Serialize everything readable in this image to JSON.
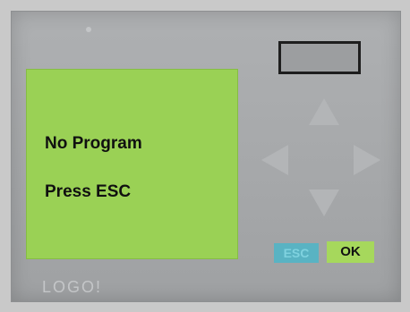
{
  "display": {
    "line1": "No Program",
    "line2": "Press ESC"
  },
  "keys": {
    "esc_label": "ESC",
    "ok_label": "OK"
  },
  "brand": {
    "logo_text": "LOGO!"
  },
  "colors": {
    "lcd_background": "#9ad155",
    "esc_key": "#59b3c3",
    "ok_key": "#a6d85c",
    "housing": "#a6a8aa"
  }
}
